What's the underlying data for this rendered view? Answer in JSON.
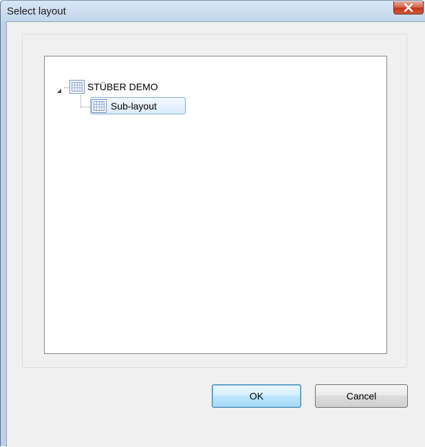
{
  "window": {
    "title": "Select layout",
    "close_icon": "close-icon"
  },
  "tree": {
    "nodes": [
      {
        "label": "STÜBER DEMO",
        "icon": "grid-layout-icon",
        "expanded": true
      },
      {
        "label": "Sub-layout",
        "icon": "grid-layout-icon",
        "selected": true
      }
    ]
  },
  "buttons": {
    "ok_label": "OK",
    "cancel_label": "Cancel"
  },
  "colors": {
    "selection_border": "#84acdd",
    "close_button": "#c2351a",
    "default_button_border": "#3c7fb1"
  }
}
